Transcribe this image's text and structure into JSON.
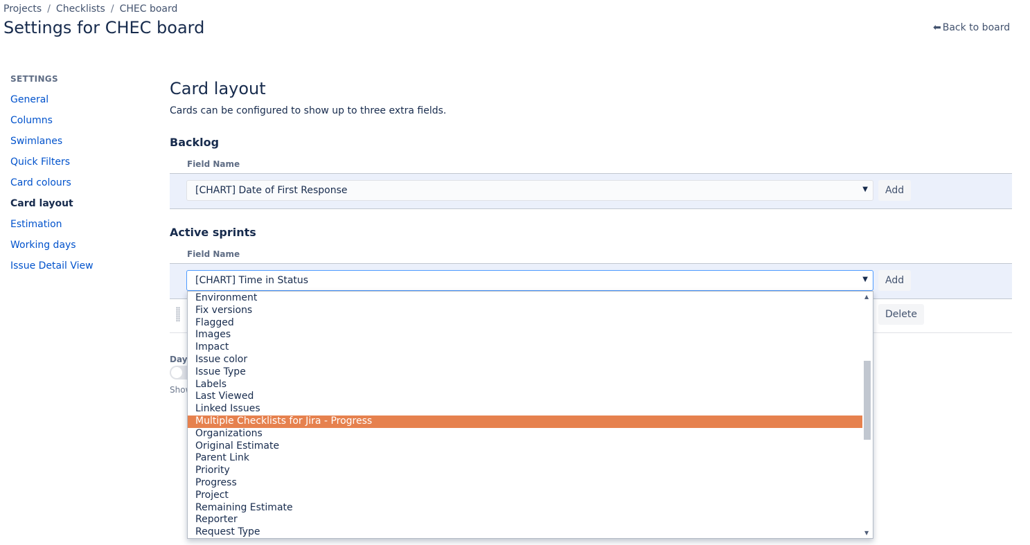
{
  "breadcrumb": {
    "items": [
      "Projects",
      "Checklists",
      "CHEC board"
    ],
    "separator": "/"
  },
  "page_title": "Settings for CHEC board",
  "back_link": {
    "icon": "arrow-left-icon",
    "label": "Back to board"
  },
  "sidebar": {
    "heading": "SETTINGS",
    "items": [
      {
        "label": "General",
        "active": false
      },
      {
        "label": "Columns",
        "active": false
      },
      {
        "label": "Swimlanes",
        "active": false
      },
      {
        "label": "Quick Filters",
        "active": false
      },
      {
        "label": "Card colours",
        "active": false
      },
      {
        "label": "Card layout",
        "active": true
      },
      {
        "label": "Estimation",
        "active": false
      },
      {
        "label": "Working days",
        "active": false
      },
      {
        "label": "Issue Detail View",
        "active": false
      }
    ]
  },
  "main": {
    "title": "Card layout",
    "description": "Cards can be configured to show up to three extra fields.",
    "backlog": {
      "heading": "Backlog",
      "field_label": "Field Name",
      "selected_value": "[CHART] Date of First Response",
      "add_label": "Add"
    },
    "active_sprints": {
      "heading": "Active sprints",
      "field_label": "Field Name",
      "selected_value": "[CHART] Time in Status",
      "add_label": "Add",
      "delete_label": "Delete"
    },
    "days_label": "Days",
    "show_label": "Show"
  },
  "dropdown": {
    "options": [
      "Environment",
      "Fix versions",
      "Flagged",
      "Images",
      "Impact",
      "Issue color",
      "Issue Type",
      "Labels",
      "Last Viewed",
      "Linked Issues",
      "Multiple Checklists for Jira - Progress",
      "Organizations",
      "Original Estimate",
      "Parent Link",
      "Priority",
      "Progress",
      "Project",
      "Remaining Estimate",
      "Reporter",
      "Request Type"
    ],
    "highlighted": "Multiple Checklists for Jira - Progress"
  },
  "colors": {
    "text_primary": "#172b4d",
    "link": "#0052cc",
    "highlight": "#e6814e",
    "row_band": "#ebf0fb",
    "focus_border": "#4c9aff"
  }
}
